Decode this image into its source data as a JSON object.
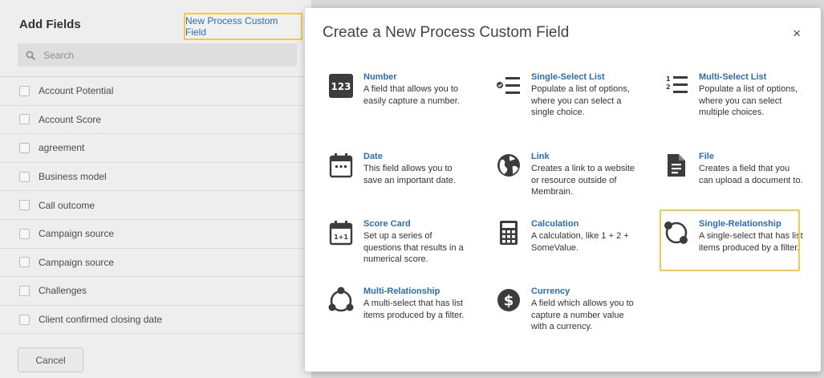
{
  "left_panel": {
    "title": "Add Fields",
    "new_field_link": "New Process Custom Field",
    "search_placeholder": "Search",
    "fields": [
      "Account Potential",
      "Account Score",
      "agreement",
      "Business model",
      "Call outcome",
      "Campaign source",
      "Campaign source",
      "Challenges",
      "Client confirmed closing date"
    ],
    "cancel_label": "Cancel"
  },
  "modal": {
    "title": "Create a New Process Custom Field",
    "close_glyph": "×",
    "options": [
      {
        "name": "Number",
        "desc": "A field that allows you to easily capture a number.",
        "icon": "number-icon"
      },
      {
        "name": "Single-Select List",
        "desc": "Populate a list of options, where you can select a single choice.",
        "icon": "single-select-list-icon"
      },
      {
        "name": "Multi-Select List",
        "desc": "Populate a list of options, where you can select multiple choices.",
        "icon": "multi-select-list-icon"
      },
      {
        "name": "Date",
        "desc": "This field allows you to save an important date.",
        "icon": "calendar-icon"
      },
      {
        "name": "Link",
        "desc": "Creates a link to a website or resource outside of Membrain.",
        "icon": "globe-icon"
      },
      {
        "name": "File",
        "desc": "Creates a field that you can upload a document to.",
        "icon": "file-icon"
      },
      {
        "name": "Score Card",
        "desc": "Set up a series of questions that results in a numerical score.",
        "icon": "score-card-icon"
      },
      {
        "name": "Calculation",
        "desc": "A calculation, like 1 + 2 + SomeValue.",
        "icon": "calculator-icon"
      },
      {
        "name": "Single-Relationship",
        "desc": "A single-select that has list items produced by a filter.",
        "icon": "single-relationship-icon"
      },
      {
        "name": "Multi-Relationship",
        "desc": "A multi-select that has list items produced by a filter.",
        "icon": "multi-relationship-icon"
      },
      {
        "name": "Currency",
        "desc": "A field which allows you to capture a number value with a currency.",
        "icon": "currency-icon"
      }
    ],
    "icon_text": {
      "number": "123",
      "score_card": "1+1",
      "list_1": "1",
      "list_2": "2"
    }
  },
  "colors": {
    "link_blue": "#2a6db0",
    "highlight_yellow": "#f2c94c",
    "icon_dark": "#3c3c3c"
  }
}
